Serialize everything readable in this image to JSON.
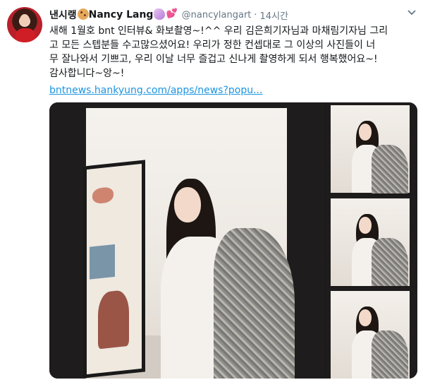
{
  "tweet": {
    "display_name": "낸시랭",
    "display_name_suffix": "Nancy Lang",
    "handle": "@nancylangart",
    "separator": "·",
    "timestamp": "14시간",
    "text_lines": [
      "새해 1월호 bnt 인터뷰& 화보촬영~!^^ 우리 김은희기자님과 마채림기자님 그리",
      "고 모든 스텝분들 수고많으셨어요! 우리가 정한 컨셉대로 그 이상의 사진들이 너",
      "무 잘나와서 기쁘고, 우리 이날 너무 즐겁고 신나게 촬영하게 되서 행복했어요~!",
      "감사합니다~앙~!"
    ],
    "link_text": "bntnews.hankyung.com/apps/news?popu...",
    "emojis": [
      "cookie-emoji",
      "unicorn-emoji",
      "two-hearts-emoji"
    ]
  },
  "colors": {
    "link": "#1b95e0",
    "secondary_text": "#657786",
    "primary_text": "#14171a",
    "heart": "#e0245e"
  },
  "icons": {
    "caret": "chevron-down-icon"
  }
}
